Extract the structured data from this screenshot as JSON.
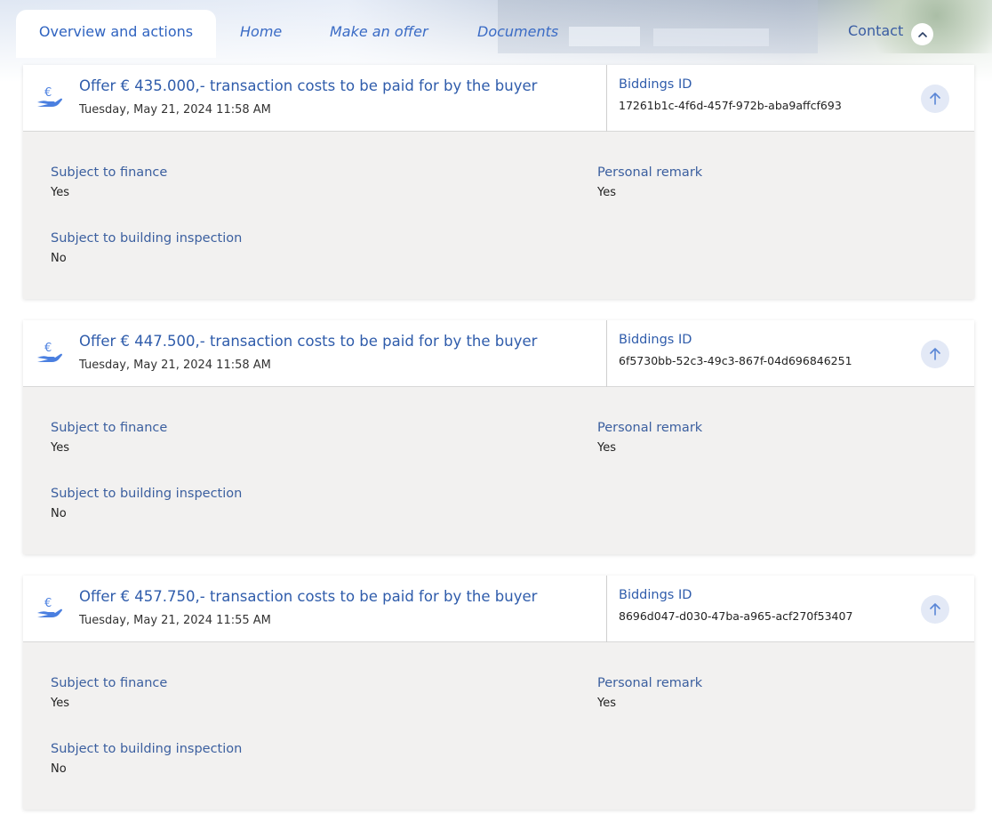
{
  "nav": {
    "tabs": [
      {
        "label": "Overview and actions",
        "active": true
      },
      {
        "label": "Home"
      },
      {
        "label": "Make an offer"
      },
      {
        "label": "Documents"
      }
    ],
    "contact_label": "Contact"
  },
  "colors": {
    "accent": "#2f5cab",
    "icon_blue": "#4a7fe0",
    "panel_bg": "#f2f1f0"
  },
  "offers": [
    {
      "title": "Offer € 435.000,- transaction costs to be paid for by the buyer",
      "date": "Tuesday, May 21, 2024 11:58 AM",
      "biddings_id_label": "Biddings ID",
      "biddings_id": "17261b1c-4f6d-457f-972b-aba9affcf693",
      "fields": {
        "finance_label": "Subject to finance",
        "finance_value": "Yes",
        "remark_label": "Personal remark",
        "remark_value": "Yes",
        "inspection_label": "Subject to building inspection",
        "inspection_value": "No"
      }
    },
    {
      "title": "Offer € 447.500,- transaction costs to be paid for by the buyer",
      "date": "Tuesday, May 21, 2024 11:58 AM",
      "biddings_id_label": "Biddings ID",
      "biddings_id": "6f5730bb-52c3-49c3-867f-04d696846251",
      "fields": {
        "finance_label": "Subject to finance",
        "finance_value": "Yes",
        "remark_label": "Personal remark",
        "remark_value": "Yes",
        "inspection_label": "Subject to building inspection",
        "inspection_value": "No"
      }
    },
    {
      "title": "Offer € 457.750,- transaction costs to be paid for by the buyer",
      "date": "Tuesday, May 21, 2024 11:55 AM",
      "biddings_id_label": "Biddings ID",
      "biddings_id": "8696d047-d030-47ba-a965-acf270f53407",
      "fields": {
        "finance_label": "Subject to finance",
        "finance_value": "Yes",
        "remark_label": "Personal remark",
        "remark_value": "Yes",
        "inspection_label": "Subject to building inspection",
        "inspection_value": "No"
      }
    }
  ]
}
